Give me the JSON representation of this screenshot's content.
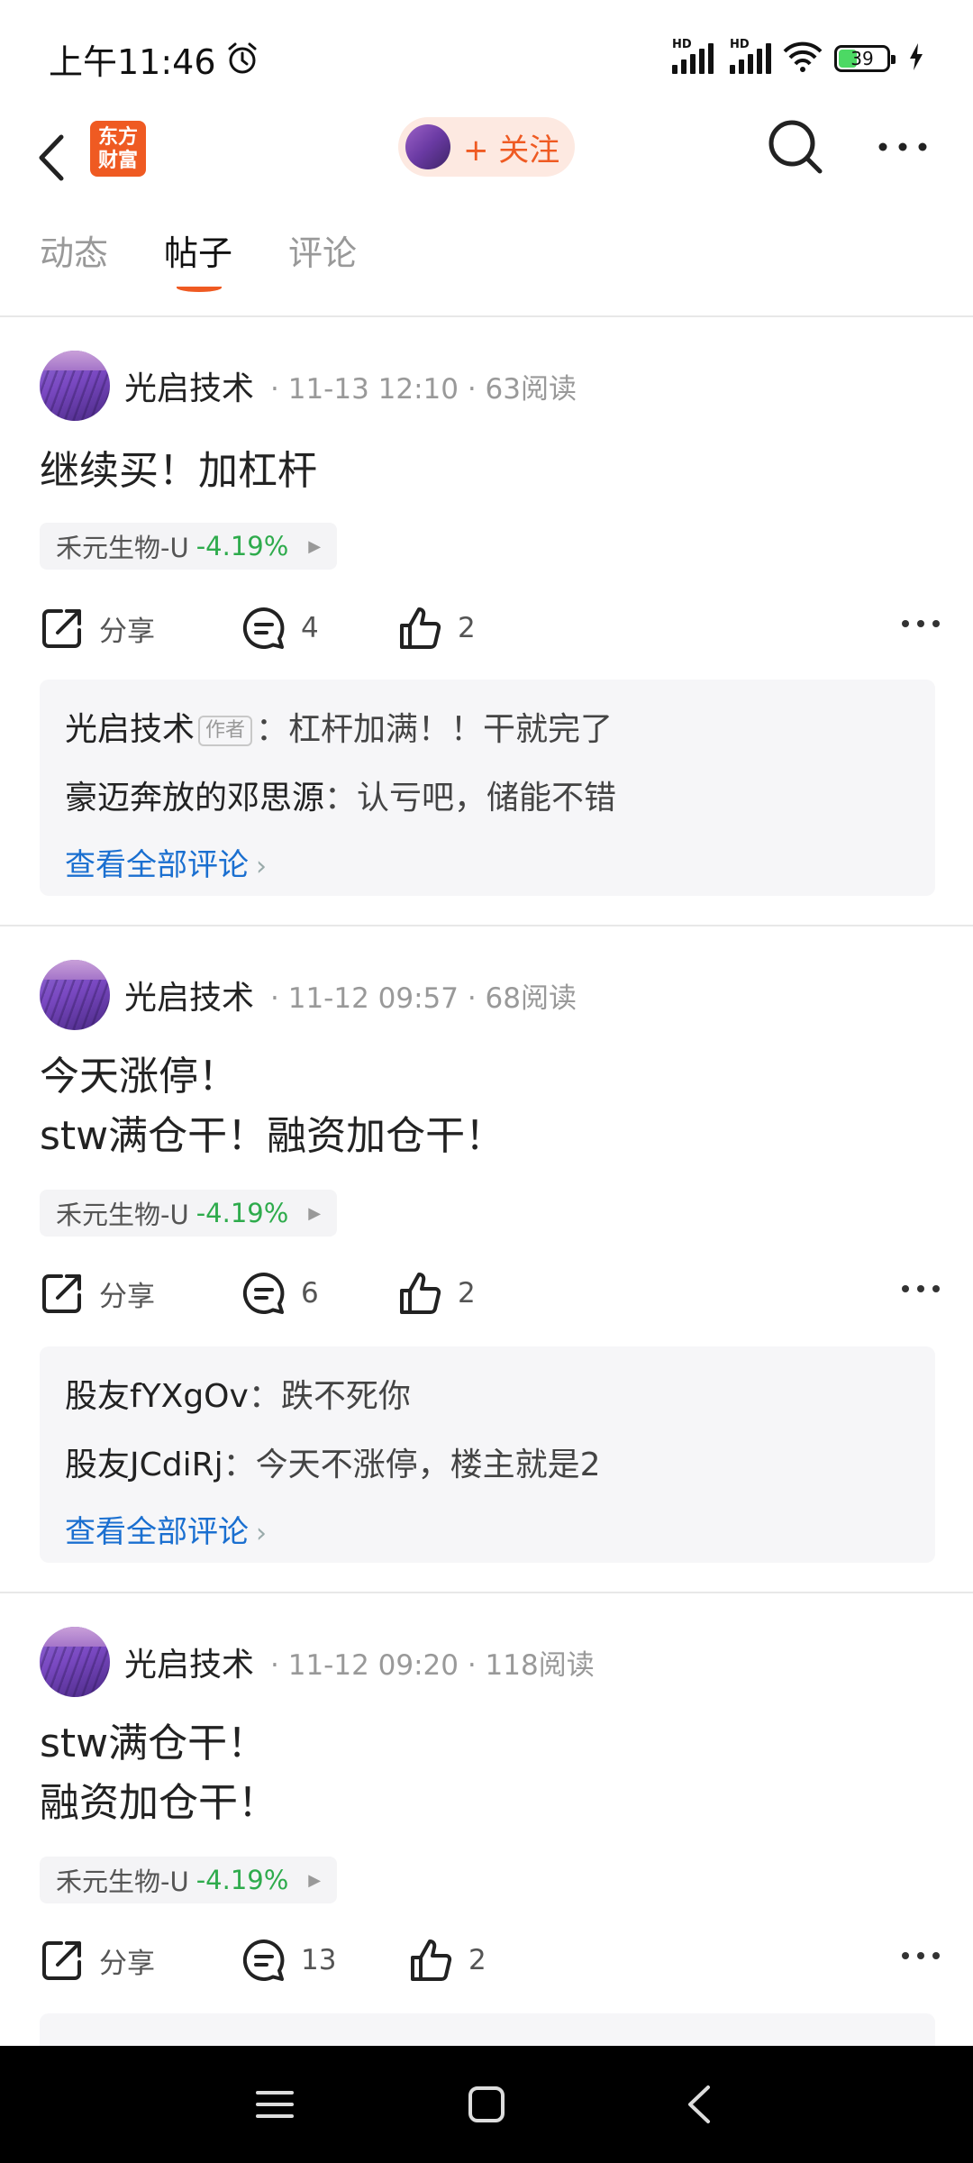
{
  "status_bar": {
    "time": "上午11:46",
    "battery": "39",
    "battery_level": 0.39
  },
  "header": {
    "logo_text": "东方\n财富",
    "follow_label": "+ 关注"
  },
  "tabs": [
    {
      "label": "动态",
      "active": false
    },
    {
      "label": "帖子",
      "active": true
    },
    {
      "label": "评论",
      "active": false
    }
  ],
  "colors": {
    "accent": "#ef5a22",
    "link": "#1a6fd0",
    "stock_down": "#2eab4c"
  },
  "posts": [
    {
      "author": "光启技术",
      "meta": "· 11-13 12:10 · 63阅读",
      "lines": [
        "继续买！加杠杆"
      ],
      "stock": {
        "name": "禾元生物-U",
        "change": "-4.19%"
      },
      "share_label": "分享",
      "comment_count": "4",
      "like_count": "2",
      "comments": [
        {
          "name": "光启技术",
          "badge": "作者",
          "text": "：杠杆加满！！干就完了"
        },
        {
          "name": "豪迈奔放的邓思源",
          "badge": "",
          "text": "：认亏吧，储能不错"
        }
      ],
      "view_all": "查看全部评论"
    },
    {
      "author": "光启技术",
      "meta": "· 11-12 09:57 · 68阅读",
      "lines": [
        "今天涨停！",
        "stw满仓干！融资加仓干！"
      ],
      "stock": {
        "name": "禾元生物-U",
        "change": "-4.19%"
      },
      "share_label": "分享",
      "comment_count": "6",
      "like_count": "2",
      "comments": [
        {
          "name": "股友fYXgOv",
          "badge": "",
          "text": "：跌不死你"
        },
        {
          "name": "股友JCdiRj",
          "badge": "",
          "text": "：今天不涨停，楼主就是2"
        }
      ],
      "view_all": "查看全部评论"
    },
    {
      "author": "光启技术",
      "meta": "· 11-12 09:20 · 118阅读",
      "lines": [
        "stw满仓干！",
        "融资加仓干！"
      ],
      "stock": {
        "name": "禾元生物-U",
        "change": "-4.19%"
      },
      "share_label": "分享",
      "comment_count": "13",
      "like_count": "2",
      "comments": [],
      "view_all": ""
    }
  ]
}
